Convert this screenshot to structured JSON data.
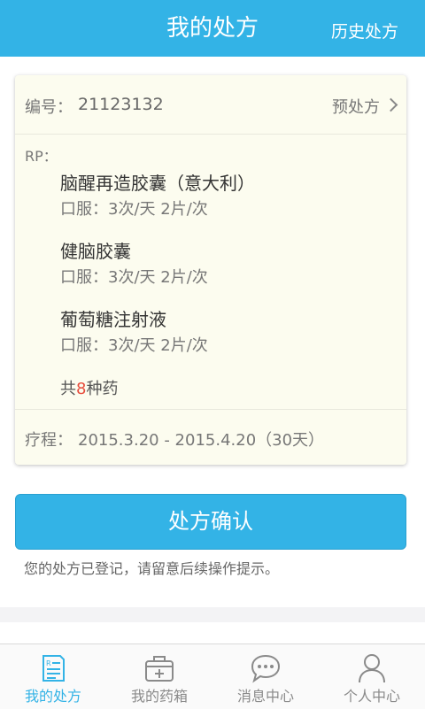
{
  "header": {
    "title": "我的处方",
    "right_label": "历史处方"
  },
  "prescription": {
    "code_label": "编号：",
    "code_value": "21123132",
    "pre_label": "预处方",
    "rp_label": "RP：",
    "medicines": [
      {
        "name": "脑醒再造胶囊（意大利）",
        "dose": "口服：3次/天  2片/次"
      },
      {
        "name": "健脑胶囊",
        "dose": "口服：3次/天  2片/次"
      },
      {
        "name": "葡萄糖注射液",
        "dose": "口服：3次/天  2片/次"
      }
    ],
    "total_prefix": "共",
    "total_count": "8",
    "total_suffix": "种药",
    "course_label": "疗程：",
    "course_value": "2015.3.20 - 2015.4.20（30天）"
  },
  "confirm_label": "处方确认",
  "tip": "您的处方已登记，请留意后续操作提示。",
  "tabs": [
    {
      "label": "我的处方",
      "icon": "prescription-icon"
    },
    {
      "label": "我的药箱",
      "icon": "medicine-box-icon"
    },
    {
      "label": "消息中心",
      "icon": "chat-bubble-icon"
    },
    {
      "label": "个人中心",
      "icon": "person-icon"
    }
  ],
  "colors": {
    "accent": "#33b3e6",
    "card_bg": "#fcfcef",
    "highlight": "#e74c3c"
  }
}
